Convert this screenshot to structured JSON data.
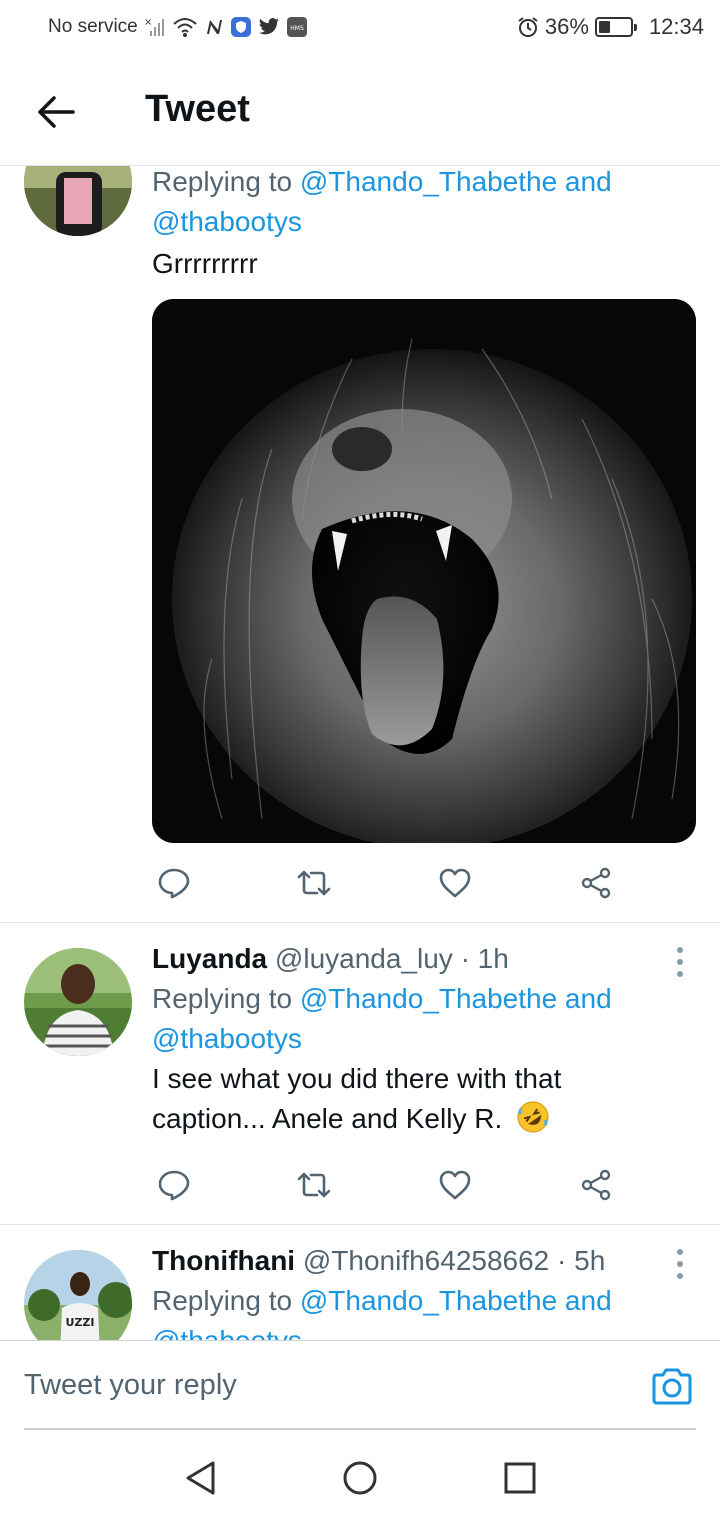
{
  "status_bar": {
    "carrier": "No service",
    "battery_percent": "36%",
    "time": "12:34",
    "icons": [
      "signal-x-icon",
      "wifi-icon",
      "n-app-icon",
      "shield-app-icon",
      "twitter-bird-icon",
      "hms-icon",
      "alarm-icon",
      "battery-icon"
    ]
  },
  "header": {
    "title": "Tweet",
    "back_icon": "arrow-left-icon"
  },
  "tweets": [
    {
      "replying_prefix": "Replying to",
      "mention1": "@Thando_Thabethe and",
      "mention2": "@thabootys",
      "text": "Grrrrrrrrr",
      "media": "lion-roaring-photo"
    },
    {
      "name": "Luyanda",
      "handle": "@luyanda_luy",
      "time": "· 1h",
      "replying_prefix": "Replying to",
      "mention1": "@Thando_Thabethe and",
      "mention2": "@thabootys",
      "text_line1": "I see what you did there with that",
      "text_line2": "caption... Anele and Kelly R.",
      "emoji": "rolling-on-floor-laughing-emoji"
    },
    {
      "name": "Thonifhani",
      "handle": "@Thonifh64258662",
      "time": "· 5h",
      "replying_prefix": "Replying to",
      "mention1": "@Thando_Thabethe and",
      "mention2": "@thabootys"
    }
  ],
  "actions": [
    "reply-icon",
    "retweet-icon",
    "like-icon",
    "share-icon"
  ],
  "reply_bar": {
    "placeholder": "Tweet your reply",
    "camera_icon": "camera-icon"
  },
  "nav_bar": [
    "back-triangle-icon",
    "home-circle-icon",
    "recents-square-icon"
  ],
  "colors": {
    "accent": "#1b95e0",
    "text": "#0f1419",
    "muted": "#536471",
    "divider": "#e1e4e8"
  }
}
